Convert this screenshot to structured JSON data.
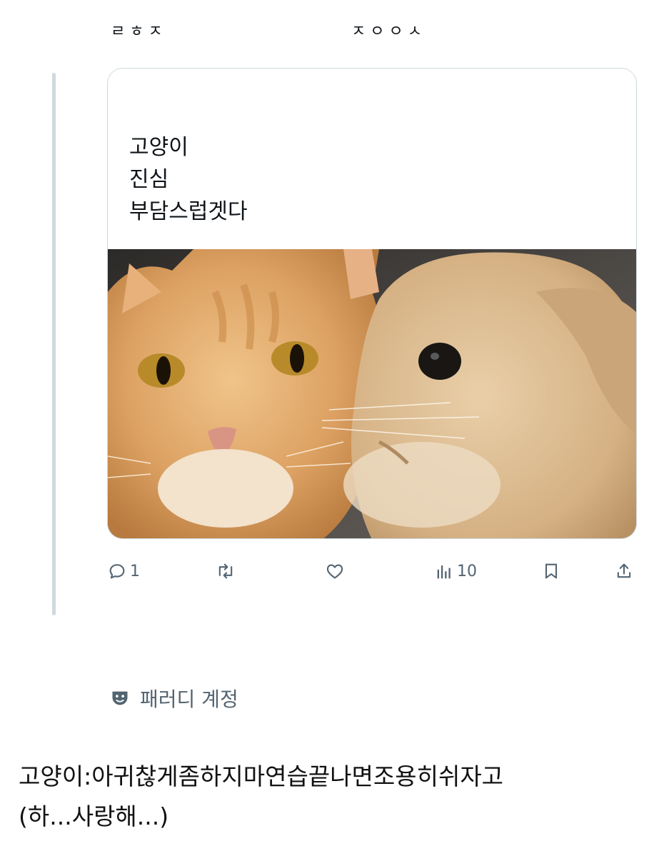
{
  "header": {
    "left_text": "ㄹㅎㅈ",
    "right_text": "ㅈㅇㅇㅅ"
  },
  "card": {
    "lines": [
      "고양이",
      "진심",
      "부담스럽겟다"
    ],
    "photo": "cat-and-rabbit-photo"
  },
  "actions": {
    "reply_count": "1",
    "views_count": "10",
    "icons": [
      "reply-icon",
      "retweet-icon",
      "like-icon",
      "views-icon",
      "bookmark-icon",
      "share-icon"
    ]
  },
  "parody": {
    "label": "패러디 계정",
    "icon": "theater-mask-icon"
  },
  "caption": {
    "line1": "고양이:아귀찮게좀하지마연습끝나면조용히쉬자고",
    "line2": "(하...사랑해...)"
  },
  "colors": {
    "text": "#0f1419",
    "muted": "#536471",
    "border": "#cfd9de"
  }
}
